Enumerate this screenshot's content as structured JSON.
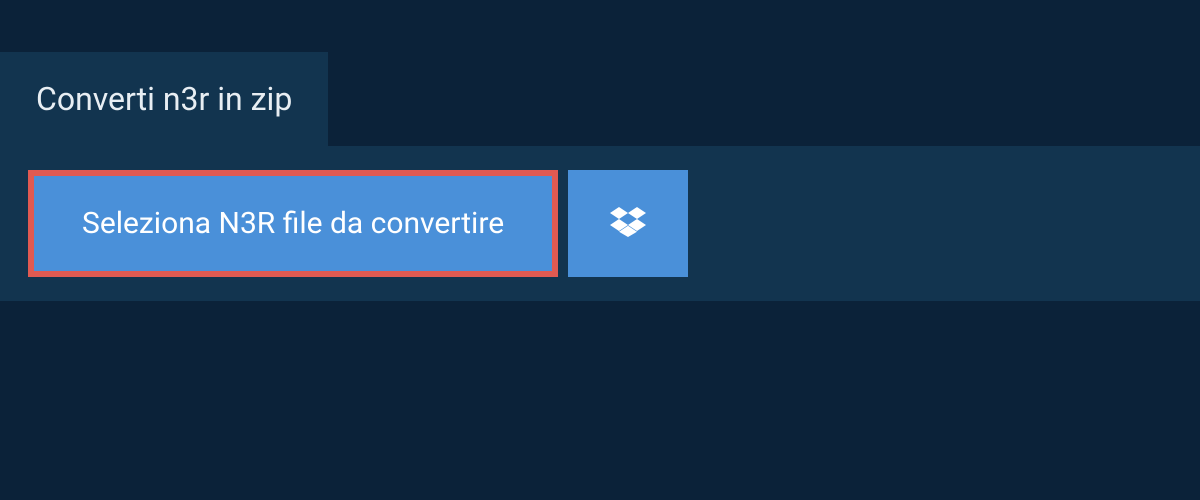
{
  "tab": {
    "label": "Converti n3r in zip"
  },
  "actions": {
    "select_file_label": "Seleziona N3R file da convertire",
    "dropbox_icon": "dropbox-icon"
  },
  "colors": {
    "background": "#0b2239",
    "panel": "#12344f",
    "button": "#4a90d9",
    "highlight_border": "#e05a52",
    "text_light": "#ffffff"
  }
}
